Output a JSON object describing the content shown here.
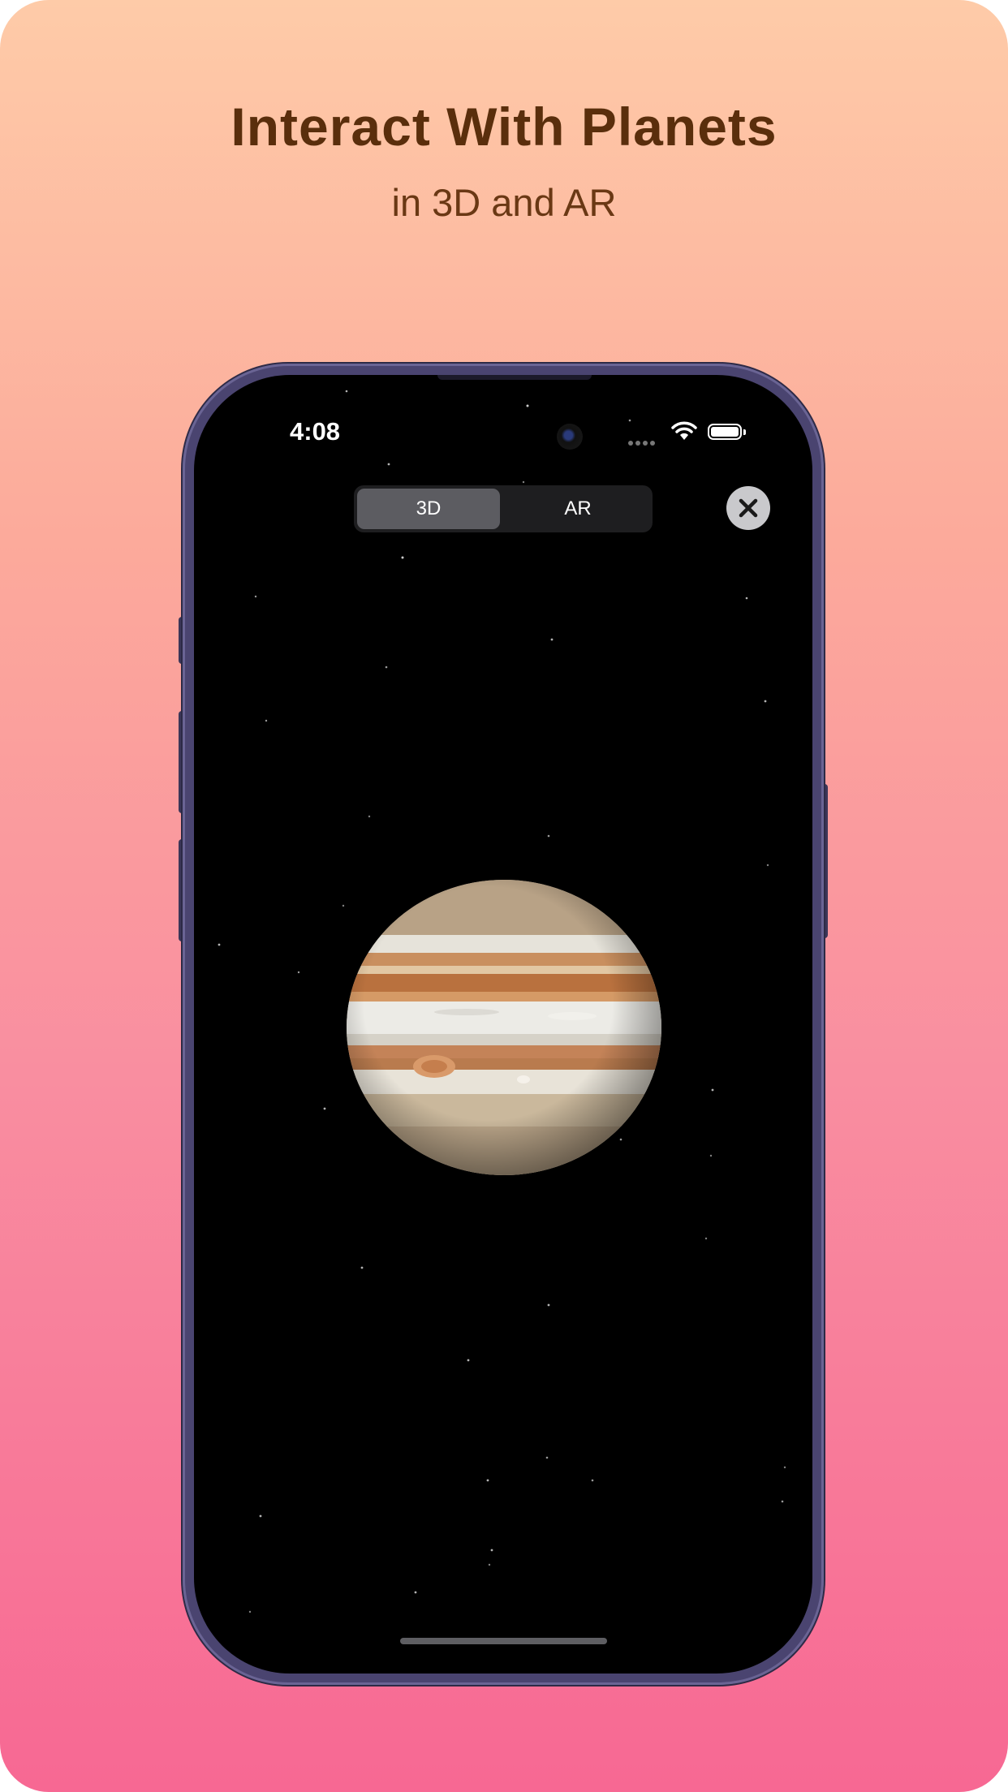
{
  "promo": {
    "headline": "Interact With Planets",
    "subheadline": "in 3D and AR"
  },
  "status_bar": {
    "time": "4:08",
    "icons": [
      "camera-icon",
      "signal-dots-icon",
      "wifi-icon",
      "battery-icon"
    ]
  },
  "view_mode": {
    "options": [
      "3D",
      "AR"
    ],
    "selected": "3D"
  },
  "close_button": {
    "icon": "close-icon"
  },
  "viewer": {
    "planet_icon": "planet-jupiter-icon",
    "background": "starfield"
  },
  "colors": {
    "headline": "#5a2e0c",
    "gradient_top": "#fecba8",
    "gradient_bottom": "#f76893",
    "screen_bg": "#000000"
  }
}
